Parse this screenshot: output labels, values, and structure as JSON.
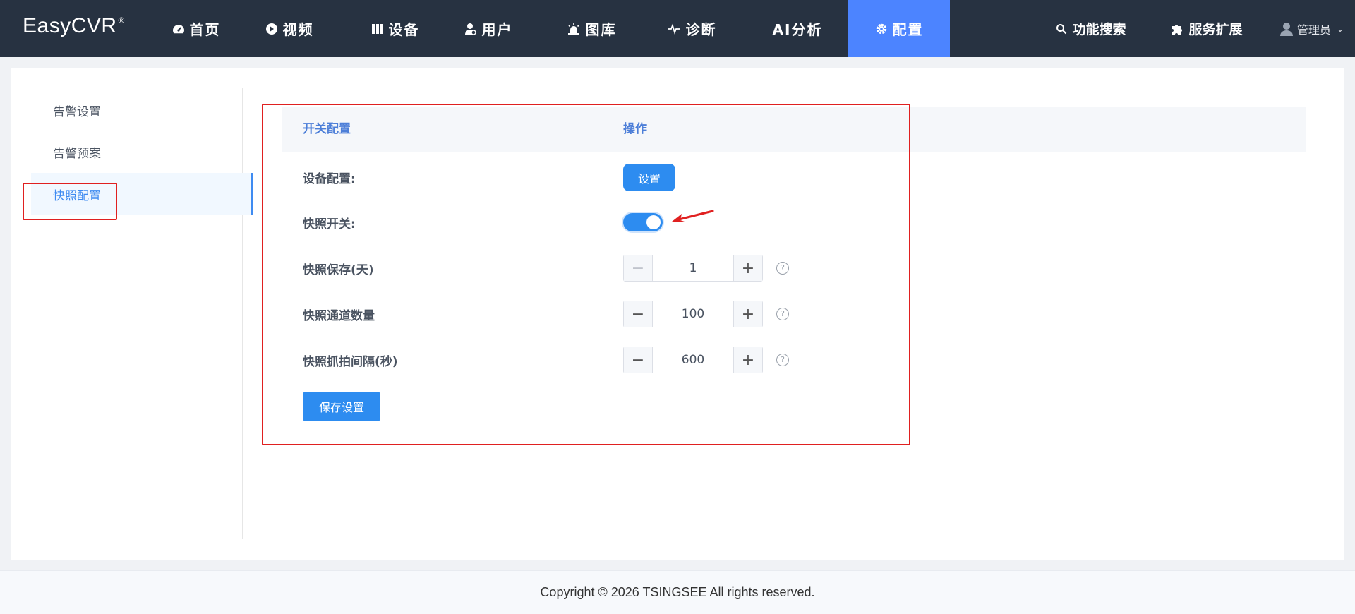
{
  "app": {
    "logo": "EasyCVR",
    "logo_mark": "®"
  },
  "nav": {
    "items": [
      {
        "label": "首页",
        "icon": "dashboard-icon"
      },
      {
        "label": "视频",
        "icon": "play-icon"
      },
      {
        "label": "设备",
        "icon": "device-icon"
      },
      {
        "label": "用户",
        "icon": "user-icon"
      },
      {
        "label": "图库",
        "icon": "alarm-icon"
      },
      {
        "label": "诊断",
        "icon": "pulse-icon"
      },
      {
        "label": "AI分析",
        "icon": ""
      },
      {
        "label": "配置",
        "icon": "gear-icon",
        "active": true
      }
    ],
    "search_label": "功能搜索",
    "extend_label": "服务扩展",
    "user_name": "管理员"
  },
  "sidebar": {
    "items": [
      {
        "label": "告警设置"
      },
      {
        "label": "告警预案"
      },
      {
        "label": "快照配置",
        "active": true
      }
    ]
  },
  "table": {
    "col_switch": "开关配置",
    "col_action": "操作",
    "device_config_label": "设备配置:",
    "device_config_button": "设置",
    "snapshot_switch_label": "快照开关:",
    "snapshot_switch_on": true,
    "save_days_label": "快照保存(天)",
    "save_days_value": "1",
    "channel_count_label": "快照通道数量",
    "channel_count_value": "100",
    "interval_label": "快照抓拍间隔(秒)",
    "interval_value": "600",
    "save_button": "保存设置"
  },
  "footer": {
    "copyright": "Copyright © 2026 TSINGSEE All rights reserved."
  },
  "colors": {
    "topbar": "#273241",
    "accent": "#4c84ff",
    "primary_button": "#2d8cf0",
    "highlight_box": "#e02020"
  }
}
